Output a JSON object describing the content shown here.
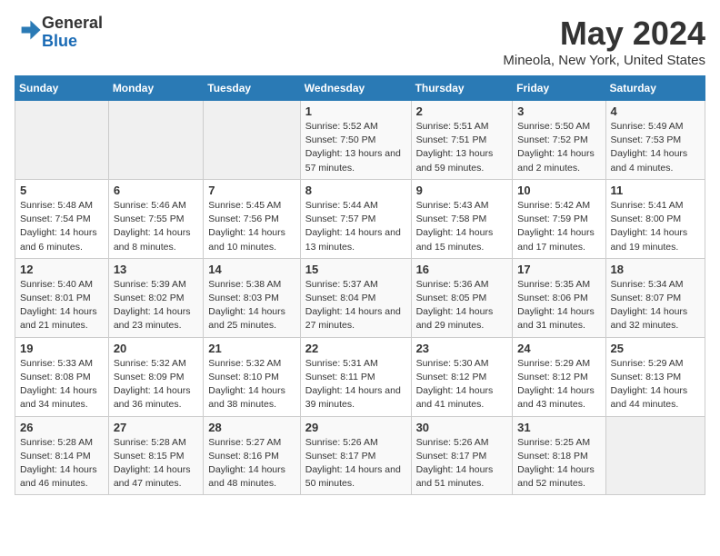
{
  "header": {
    "logo_general": "General",
    "logo_blue": "Blue",
    "title": "May 2024",
    "subtitle": "Mineola, New York, United States"
  },
  "days_of_week": [
    "Sunday",
    "Monday",
    "Tuesday",
    "Wednesday",
    "Thursday",
    "Friday",
    "Saturday"
  ],
  "weeks": [
    [
      {
        "num": "",
        "info": ""
      },
      {
        "num": "",
        "info": ""
      },
      {
        "num": "",
        "info": ""
      },
      {
        "num": "1",
        "info": "Sunrise: 5:52 AM\nSunset: 7:50 PM\nDaylight: 13 hours and 57 minutes."
      },
      {
        "num": "2",
        "info": "Sunrise: 5:51 AM\nSunset: 7:51 PM\nDaylight: 13 hours and 59 minutes."
      },
      {
        "num": "3",
        "info": "Sunrise: 5:50 AM\nSunset: 7:52 PM\nDaylight: 14 hours and 2 minutes."
      },
      {
        "num": "4",
        "info": "Sunrise: 5:49 AM\nSunset: 7:53 PM\nDaylight: 14 hours and 4 minutes."
      }
    ],
    [
      {
        "num": "5",
        "info": "Sunrise: 5:48 AM\nSunset: 7:54 PM\nDaylight: 14 hours and 6 minutes."
      },
      {
        "num": "6",
        "info": "Sunrise: 5:46 AM\nSunset: 7:55 PM\nDaylight: 14 hours and 8 minutes."
      },
      {
        "num": "7",
        "info": "Sunrise: 5:45 AM\nSunset: 7:56 PM\nDaylight: 14 hours and 10 minutes."
      },
      {
        "num": "8",
        "info": "Sunrise: 5:44 AM\nSunset: 7:57 PM\nDaylight: 14 hours and 13 minutes."
      },
      {
        "num": "9",
        "info": "Sunrise: 5:43 AM\nSunset: 7:58 PM\nDaylight: 14 hours and 15 minutes."
      },
      {
        "num": "10",
        "info": "Sunrise: 5:42 AM\nSunset: 7:59 PM\nDaylight: 14 hours and 17 minutes."
      },
      {
        "num": "11",
        "info": "Sunrise: 5:41 AM\nSunset: 8:00 PM\nDaylight: 14 hours and 19 minutes."
      }
    ],
    [
      {
        "num": "12",
        "info": "Sunrise: 5:40 AM\nSunset: 8:01 PM\nDaylight: 14 hours and 21 minutes."
      },
      {
        "num": "13",
        "info": "Sunrise: 5:39 AM\nSunset: 8:02 PM\nDaylight: 14 hours and 23 minutes."
      },
      {
        "num": "14",
        "info": "Sunrise: 5:38 AM\nSunset: 8:03 PM\nDaylight: 14 hours and 25 minutes."
      },
      {
        "num": "15",
        "info": "Sunrise: 5:37 AM\nSunset: 8:04 PM\nDaylight: 14 hours and 27 minutes."
      },
      {
        "num": "16",
        "info": "Sunrise: 5:36 AM\nSunset: 8:05 PM\nDaylight: 14 hours and 29 minutes."
      },
      {
        "num": "17",
        "info": "Sunrise: 5:35 AM\nSunset: 8:06 PM\nDaylight: 14 hours and 31 minutes."
      },
      {
        "num": "18",
        "info": "Sunrise: 5:34 AM\nSunset: 8:07 PM\nDaylight: 14 hours and 32 minutes."
      }
    ],
    [
      {
        "num": "19",
        "info": "Sunrise: 5:33 AM\nSunset: 8:08 PM\nDaylight: 14 hours and 34 minutes."
      },
      {
        "num": "20",
        "info": "Sunrise: 5:32 AM\nSunset: 8:09 PM\nDaylight: 14 hours and 36 minutes."
      },
      {
        "num": "21",
        "info": "Sunrise: 5:32 AM\nSunset: 8:10 PM\nDaylight: 14 hours and 38 minutes."
      },
      {
        "num": "22",
        "info": "Sunrise: 5:31 AM\nSunset: 8:11 PM\nDaylight: 14 hours and 39 minutes."
      },
      {
        "num": "23",
        "info": "Sunrise: 5:30 AM\nSunset: 8:12 PM\nDaylight: 14 hours and 41 minutes."
      },
      {
        "num": "24",
        "info": "Sunrise: 5:29 AM\nSunset: 8:12 PM\nDaylight: 14 hours and 43 minutes."
      },
      {
        "num": "25",
        "info": "Sunrise: 5:29 AM\nSunset: 8:13 PM\nDaylight: 14 hours and 44 minutes."
      }
    ],
    [
      {
        "num": "26",
        "info": "Sunrise: 5:28 AM\nSunset: 8:14 PM\nDaylight: 14 hours and 46 minutes."
      },
      {
        "num": "27",
        "info": "Sunrise: 5:28 AM\nSunset: 8:15 PM\nDaylight: 14 hours and 47 minutes."
      },
      {
        "num": "28",
        "info": "Sunrise: 5:27 AM\nSunset: 8:16 PM\nDaylight: 14 hours and 48 minutes."
      },
      {
        "num": "29",
        "info": "Sunrise: 5:26 AM\nSunset: 8:17 PM\nDaylight: 14 hours and 50 minutes."
      },
      {
        "num": "30",
        "info": "Sunrise: 5:26 AM\nSunset: 8:17 PM\nDaylight: 14 hours and 51 minutes."
      },
      {
        "num": "31",
        "info": "Sunrise: 5:25 AM\nSunset: 8:18 PM\nDaylight: 14 hours and 52 minutes."
      },
      {
        "num": "",
        "info": ""
      }
    ]
  ]
}
